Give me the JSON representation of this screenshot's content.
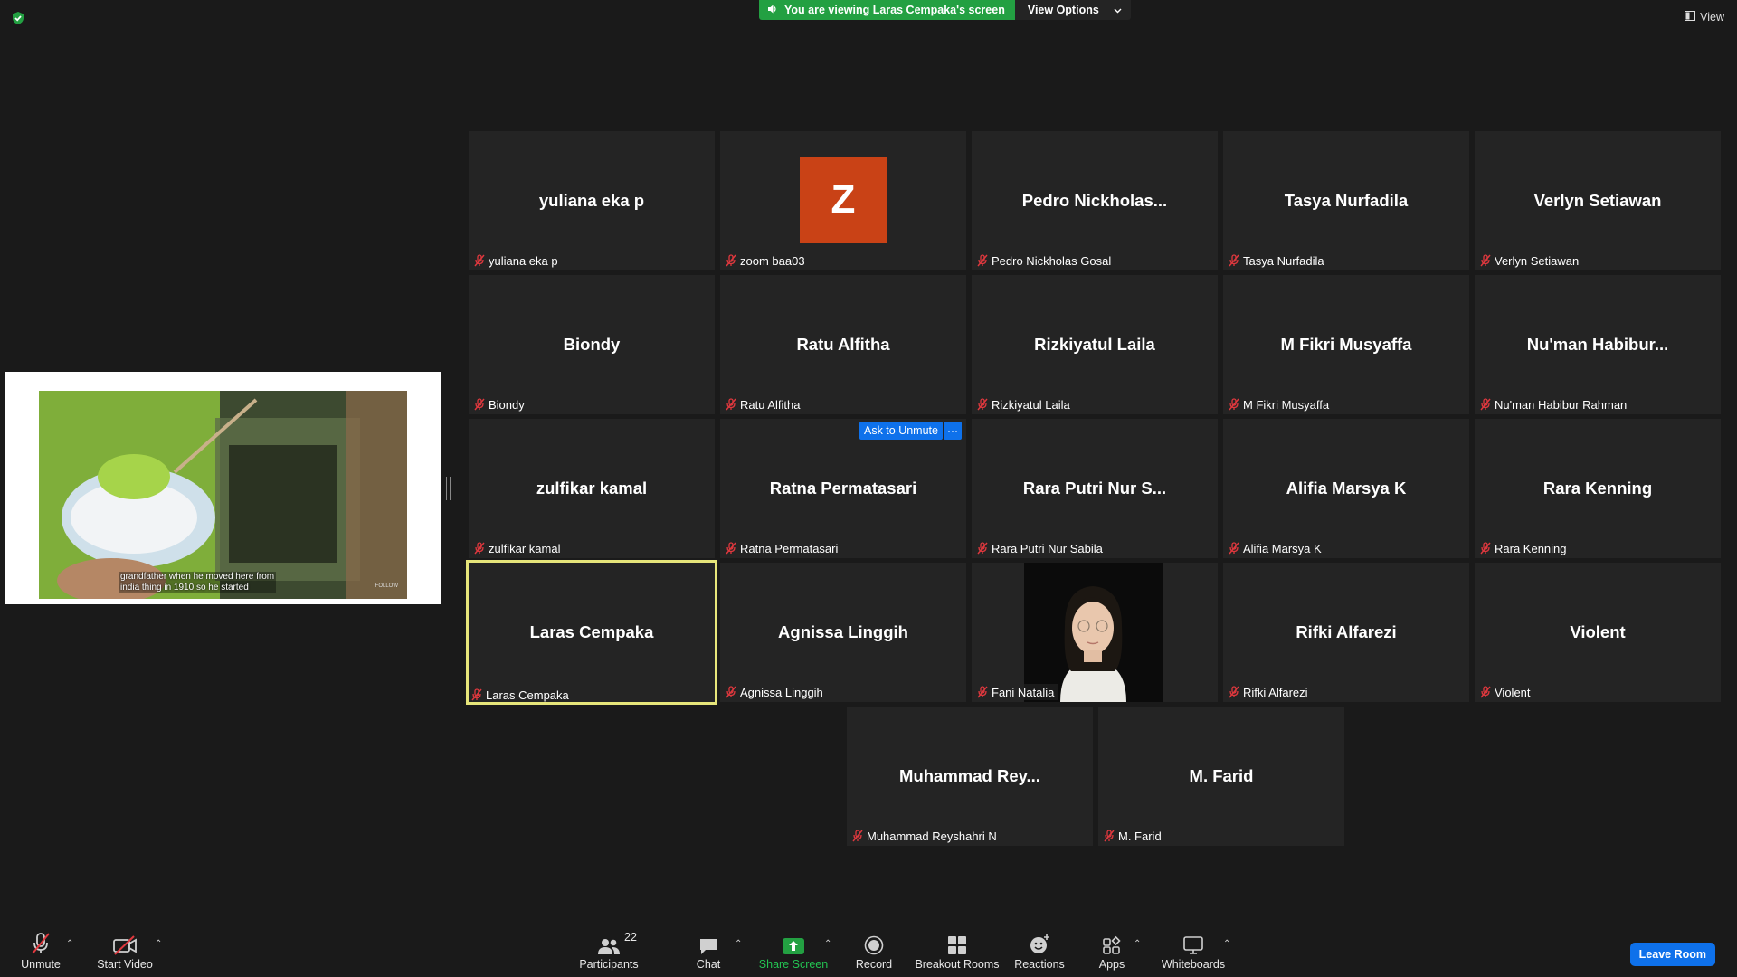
{
  "top_bar": {
    "viewing_text": "You are viewing Laras Cempaka's screen",
    "view_options_label": "View Options",
    "view_label": "View"
  },
  "shared_screen": {
    "caption_line1": "grandfather when he moved here from",
    "caption_line2": "india thing in 1910 so he started",
    "logo_text": "FOLLOW"
  },
  "tiles": [
    {
      "big_name": "yuliana eka p",
      "nameplate": "yuliana eka p",
      "kind": "name"
    },
    {
      "big_name": "Z",
      "nameplate": "zoom baa03",
      "kind": "avatar"
    },
    {
      "big_name": "Pedro  Nickholas...",
      "nameplate": "Pedro Nickholas Gosal",
      "kind": "name"
    },
    {
      "big_name": "Tasya Nurfadila",
      "nameplate": "Tasya Nurfadila",
      "kind": "name"
    },
    {
      "big_name": "Verlyn Setiawan",
      "nameplate": "Verlyn Setiawan",
      "kind": "name"
    },
    {
      "big_name": "Biondy",
      "nameplate": "Biondy",
      "kind": "name"
    },
    {
      "big_name": "Ratu Alfitha",
      "nameplate": "Ratu Alfitha",
      "kind": "name"
    },
    {
      "big_name": "Rizkiyatul Laila",
      "nameplate": "Rizkiyatul Laila",
      "kind": "name"
    },
    {
      "big_name": "M Fikri Musyaffa",
      "nameplate": "M Fikri Musyaffa",
      "kind": "name"
    },
    {
      "big_name": "Nu'man  Habibur...",
      "nameplate": "Nu'man Habibur Rahman",
      "kind": "name"
    },
    {
      "big_name": "zulfikar kamal",
      "nameplate": "zulfikar kamal",
      "kind": "name"
    },
    {
      "big_name": "Ratna Permatasari",
      "nameplate": "Ratna Permatasari",
      "kind": "name"
    },
    {
      "big_name": "Rara Putri Nur S...",
      "nameplate": "Rara Putri Nur Sabila",
      "kind": "name"
    },
    {
      "big_name": "Alifia Marsya K",
      "nameplate": "Alifia Marsya K",
      "kind": "name"
    },
    {
      "big_name": "Rara Kenning",
      "nameplate": "Rara Kenning",
      "kind": "name"
    },
    {
      "big_name": "Laras Cempaka",
      "nameplate": "Laras Cempaka",
      "kind": "name",
      "active": true
    },
    {
      "big_name": "Agnissa Linggih",
      "nameplate": "Agnissa Linggih",
      "kind": "name"
    },
    {
      "big_name": "",
      "nameplate": "Fani Natalia",
      "kind": "video"
    },
    {
      "big_name": "Rifki Alfarezi",
      "nameplate": "Rifki Alfarezi",
      "kind": "name"
    },
    {
      "big_name": "Violent",
      "nameplate": "Violent",
      "kind": "name"
    },
    {
      "big_name": "Muhammad  Rey...",
      "nameplate": "Muhammad Reyshahri N",
      "kind": "name"
    },
    {
      "big_name": "M. Farid",
      "nameplate": "M. Farid",
      "kind": "name"
    }
  ],
  "hover_controls": {
    "ask_to_unmute": "Ask to Unmute",
    "more": "···"
  },
  "toolbar": {
    "unmute": "Unmute",
    "start_video": "Start Video",
    "participants": "Participants",
    "participants_count": "22",
    "chat": "Chat",
    "share_screen": "Share Screen",
    "record": "Record",
    "breakout_rooms": "Breakout Rooms",
    "reactions": "Reactions",
    "apps": "Apps",
    "whiteboards": "Whiteboards",
    "leave_room": "Leave Room"
  },
  "colors": {
    "share_green": "#23a042",
    "accent_blue": "#0e71eb",
    "active_speaker": "#e6e57a",
    "mic_off_red": "#e0383e",
    "tile_bg": "#242424",
    "app_bg": "#1a1a1a"
  }
}
